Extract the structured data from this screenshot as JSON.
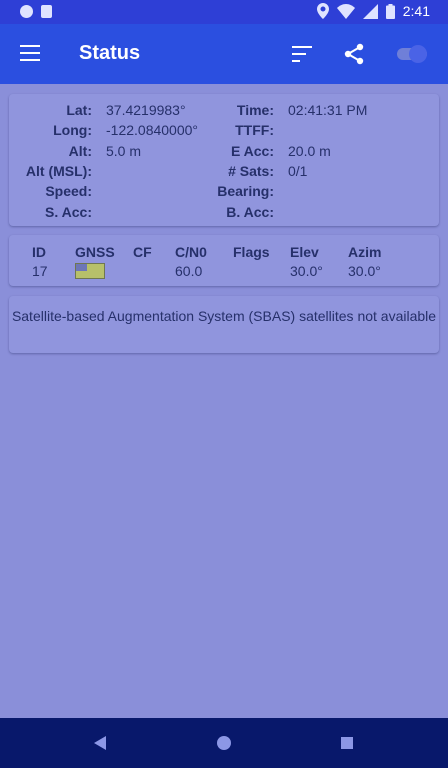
{
  "statusbar": {
    "time": "2:41"
  },
  "toolbar": {
    "title": "Status"
  },
  "status": {
    "lat_label": "Lat:",
    "lat_value": "37.4219983°",
    "long_label": "Long:",
    "long_value": "-122.0840000°",
    "alt_label": "Alt:",
    "alt_value": "5.0 m",
    "altmsl_label": "Alt (MSL):",
    "altmsl_value": "",
    "speed_label": "Speed:",
    "speed_value": "",
    "sacc_label": "S. Acc:",
    "sacc_value": "",
    "time_label": "Time:",
    "time_value": "02:41:31 PM",
    "ttff_label": "TTFF:",
    "ttff_value": "",
    "eacc_label": "E Acc:",
    "eacc_value": "20.0 m",
    "sats_label": "# Sats:",
    "sats_value": "0/1",
    "bearing_label": "Bearing:",
    "bearing_value": "",
    "bacc_label": "B. Acc:",
    "bacc_value": ""
  },
  "satellites": {
    "headers": [
      "ID",
      "GNSS",
      "CF",
      "C/N0",
      "Flags",
      "Elev",
      "Azim"
    ],
    "row": {
      "id": "17",
      "gnss_icon": "us-flag-icon",
      "cf": "",
      "cn0": "60.0",
      "flags": "",
      "elev": "30.0°",
      "azim": "30.0°"
    }
  },
  "sbas": {
    "message": "Satellite-based Augmentation System (SBAS) satellites not available"
  }
}
